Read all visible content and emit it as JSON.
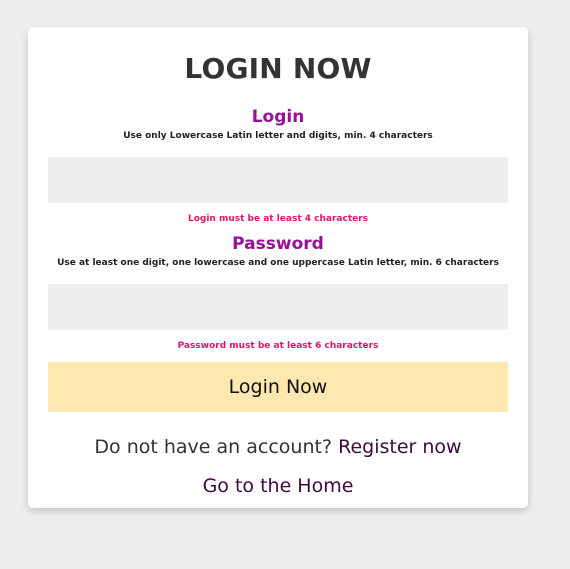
{
  "form": {
    "title": "LOGIN NOW",
    "login": {
      "label": "Login",
      "hint": "Use only Lowercase Latin letter and digits, min. 4 characters",
      "value": "",
      "error": "Login must be at least 4 characters"
    },
    "password": {
      "label": "Password",
      "hint": "Use at least one digit, one lowercase and one uppercase Latin letter, min. 6 characters",
      "value": "",
      "error": "Password must be at least 6 characters"
    },
    "submit_label": "Login Now",
    "register_prompt": "Do not have an account?",
    "register_link": "Register now",
    "home_link": "Go to the Home"
  },
  "colors": {
    "background": "#eeeeee",
    "card": "#ffffff",
    "label": "#9a0f9a",
    "error": "#e0156b",
    "button": "#ffe8b0",
    "link": "#3d0a3d",
    "input_bg": "#eeeeee"
  }
}
